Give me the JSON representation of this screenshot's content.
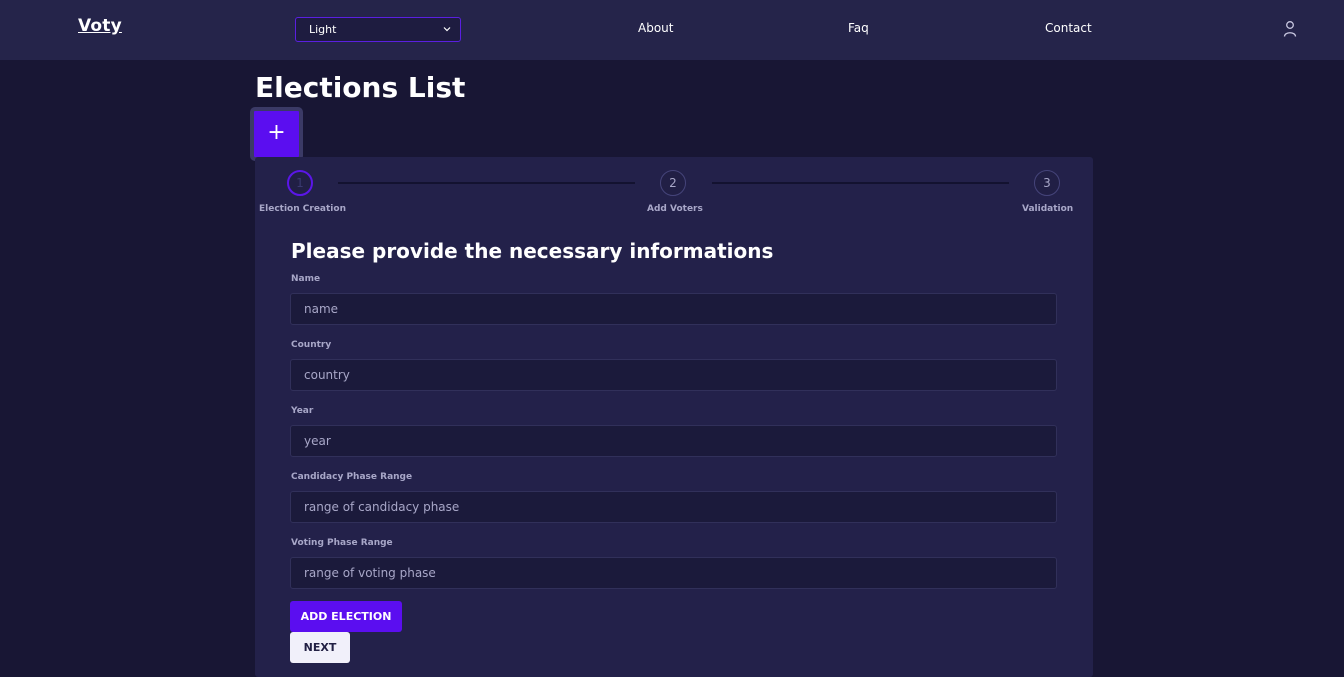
{
  "navbar": {
    "logo": "Voty",
    "theme_select": {
      "value": "Light"
    },
    "links": [
      "About",
      "Faq",
      "Contact"
    ]
  },
  "page": {
    "title": "Elections List",
    "add_button_label": "+"
  },
  "stepper": {
    "steps": [
      {
        "number": "1",
        "label": "Election Creation"
      },
      {
        "number": "2",
        "label": "Add Voters"
      },
      {
        "number": "3",
        "label": "Validation"
      }
    ],
    "active_step": 1
  },
  "form": {
    "heading": "Please provide the necessary informations",
    "fields": [
      {
        "label": "Name",
        "placeholder": "name"
      },
      {
        "label": "Country",
        "placeholder": "country"
      },
      {
        "label": "Year",
        "placeholder": "year"
      },
      {
        "label": "Candidacy Phase Range",
        "placeholder": "range of candidacy phase"
      },
      {
        "label": "Voting Phase Range",
        "placeholder": "range of voting phase"
      }
    ],
    "add_button": "ADD ELECTION",
    "next_button": "NEXT"
  },
  "colors": {
    "background": "#181634",
    "navbar": "#25244a",
    "card": "#23214a",
    "accent": "#5b0ef0"
  }
}
